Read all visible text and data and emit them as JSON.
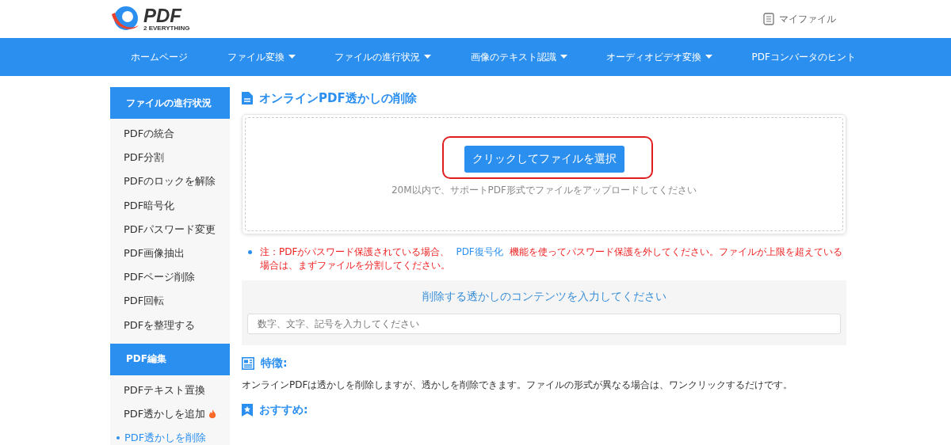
{
  "header": {
    "logo": {
      "name": "PDF",
      "tagline": "2 EVERYTHING"
    },
    "my_files": "マイファイル"
  },
  "nav": [
    {
      "label": "ホームページ",
      "has_menu": false
    },
    {
      "label": "ファイル変換",
      "has_menu": true
    },
    {
      "label": "ファイルの進行状況",
      "has_menu": true
    },
    {
      "label": "画像のテキスト認識",
      "has_menu": true
    },
    {
      "label": "オーディオビデオ変換",
      "has_menu": true
    },
    {
      "label": "PDFコンバータのヒント",
      "has_menu": false
    }
  ],
  "sidebar": [
    {
      "heading": "ファイルの進行状況",
      "items": [
        {
          "label": "PDFの統合",
          "selected": false,
          "hot": false
        },
        {
          "label": "PDF分割",
          "selected": false,
          "hot": false
        },
        {
          "label": "PDFのロックを解除",
          "selected": false,
          "hot": false
        },
        {
          "label": "PDF暗号化",
          "selected": false,
          "hot": false
        },
        {
          "label": "PDFパスワード変更",
          "selected": false,
          "hot": false
        },
        {
          "label": "PDF画像抽出",
          "selected": false,
          "hot": false
        },
        {
          "label": "PDFページ削除",
          "selected": false,
          "hot": false
        },
        {
          "label": "PDF回転",
          "selected": false,
          "hot": false
        },
        {
          "label": "PDFを整理する",
          "selected": false,
          "hot": false
        }
      ]
    },
    {
      "heading": "PDF編集",
      "items": [
        {
          "label": "PDFテキスト置換",
          "selected": false,
          "hot": false
        },
        {
          "label": "PDF透かしを追加",
          "selected": false,
          "hot": true
        },
        {
          "label": "PDF透かしを削除",
          "selected": true,
          "hot": false
        }
      ]
    }
  ],
  "main": {
    "title": "オンラインPDF透かしの削除",
    "upload": {
      "button": "クリックしてファイルを選択",
      "hint": "20M以内で、サポートPDF形式でファイルをアップロードしてください"
    },
    "note": {
      "before": "注：PDFがパスワード保護されている場合、",
      "link": "PDF復号化",
      "after": "機能を使ってパスワード保護を外してください。ファイルが上限を超えている場合は、まずファイルを分割してください。"
    },
    "watermark": {
      "heading": "削除する透かしのコンテンツを入力してください",
      "placeholder": "数字、文字、記号を入力してください"
    },
    "features": {
      "heading": "特徴:",
      "text": "オンラインPDFは透かしを削除しますが、透かしを削除できます。ファイルの形式が異なる場合は、ワンクリックするだけです。"
    },
    "recommend": {
      "heading": "おすすめ:"
    }
  }
}
